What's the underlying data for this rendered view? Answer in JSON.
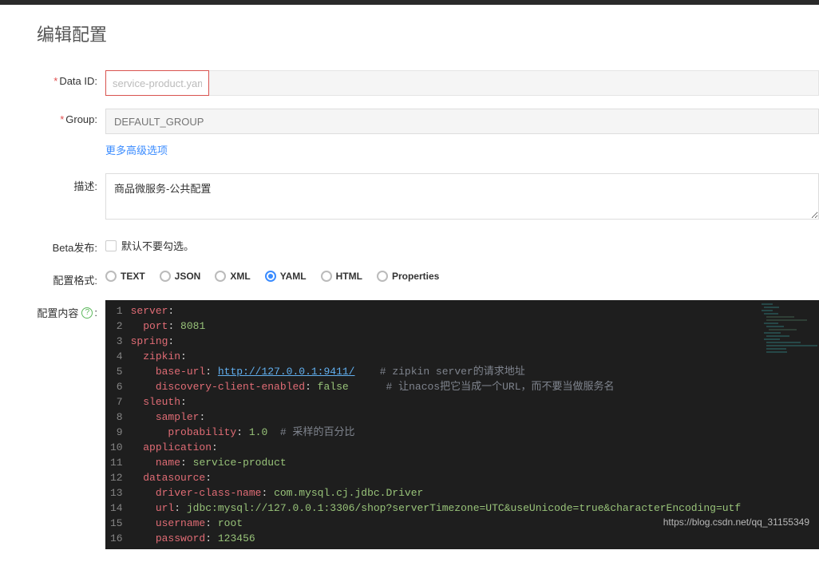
{
  "page": {
    "title": "编辑配置"
  },
  "form": {
    "dataIdLabel": "Data ID:",
    "dataIdValue": "service-product.yaml",
    "groupLabel": "Group:",
    "groupPlaceholder": "DEFAULT_GROUP",
    "moreOptions": "更多高级选项",
    "descLabel": "描述:",
    "descValue": "商品微服务-公共配置",
    "betaLabel": "Beta发布:",
    "betaCheckboxText": "默认不要勾选。",
    "formatLabel": "配置格式:",
    "formats": [
      "TEXT",
      "JSON",
      "XML",
      "YAML",
      "HTML",
      "Properties"
    ],
    "formatSelected": "YAML",
    "contentLabel": "配置内容",
    "helpIcon": "?"
  },
  "code": {
    "lines": [
      {
        "n": 1,
        "indent": 0,
        "key": "server",
        "colon": ":"
      },
      {
        "n": 2,
        "indent": 1,
        "key": "port",
        "colon": ": ",
        "scalar": "8081"
      },
      {
        "n": 3,
        "indent": 0,
        "key": "spring",
        "colon": ":"
      },
      {
        "n": 4,
        "indent": 1,
        "key": "zipkin",
        "colon": ":"
      },
      {
        "n": 5,
        "indent": 2,
        "key": "base-url",
        "colon": ": ",
        "url": "http://127.0.0.1:9411/",
        "post": "    ",
        "comment": "# zipkin server的请求地址"
      },
      {
        "n": 6,
        "indent": 2,
        "key": "discovery-client-enabled",
        "colon": ": ",
        "scalar": "false",
        "post": "      ",
        "comment": "# 让nacos把它当成一个URL，而不要当做服务名"
      },
      {
        "n": 7,
        "indent": 1,
        "key": "sleuth",
        "colon": ":"
      },
      {
        "n": 8,
        "indent": 2,
        "key": "sampler",
        "colon": ":"
      },
      {
        "n": 9,
        "indent": 3,
        "key": "probability",
        "colon": ": ",
        "scalar": "1.0",
        "post": "  ",
        "comment": "# 采样的百分比"
      },
      {
        "n": 10,
        "indent": 1,
        "key": "application",
        "colon": ":"
      },
      {
        "n": 11,
        "indent": 2,
        "key": "name",
        "colon": ": ",
        "scalar": "service-product"
      },
      {
        "n": 12,
        "indent": 1,
        "key": "datasource",
        "colon": ":"
      },
      {
        "n": 13,
        "indent": 2,
        "key": "driver-class-name",
        "colon": ": ",
        "scalar": "com.mysql.cj.jdbc.Driver"
      },
      {
        "n": 14,
        "indent": 2,
        "key": "url",
        "colon": ": ",
        "scalar": "jdbc:mysql://127.0.0.1:3306/shop?serverTimezone=UTC&useUnicode=true&characterEncoding=utf"
      },
      {
        "n": 15,
        "indent": 2,
        "key": "username",
        "colon": ": ",
        "scalar": "root"
      },
      {
        "n": 16,
        "indent": 2,
        "key": "password",
        "colon": ": ",
        "scalar": "123456"
      }
    ]
  },
  "watermark": "https://blog.csdn.net/qq_31155349"
}
